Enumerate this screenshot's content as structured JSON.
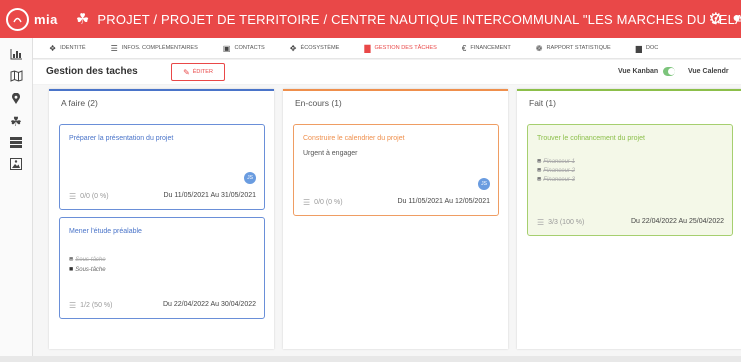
{
  "app": {
    "name": "mia"
  },
  "breadcrumb": "PROJET / PROJET DE TERRITOIRE / CENTRE NAUTIQUE INTERCOMMUNAL \"LES MARCHES DU VELAY\"",
  "colors": {
    "brand": "#e94848",
    "todo": "#4a74c9",
    "inprogress": "#ef8f4c",
    "done": "#8cbf4a"
  },
  "modules": [
    {
      "label": "IDENTITÉ",
      "icon": "fingerprint-icon"
    },
    {
      "label": "INFOS. COMPLÉMENTAIRES",
      "icon": "list-icon"
    },
    {
      "label": "CONTACTS",
      "icon": "contacts-icon"
    },
    {
      "label": "ÉCOSYSTÈME",
      "icon": "ecosystem-icon"
    },
    {
      "label": "GESTION DES TÂCHES",
      "icon": "chart-icon",
      "active": true
    },
    {
      "label": "FINANCEMENT",
      "icon": "euro-icon"
    },
    {
      "label": "RAPPORT STATISTIQUE",
      "icon": "report-icon"
    },
    {
      "label": "DOC",
      "icon": "doc-icon"
    }
  ],
  "header": {
    "title": "Gestion des taches",
    "edit_label": "ÉDITER",
    "view_kanban": "Vue Kanban",
    "view_calendar": "Vue Calendr"
  },
  "columns": {
    "todo": {
      "title": "A faire (2)",
      "cards": [
        {
          "title": "Préparer la présentation du projet",
          "progress": "0/0 (0 %)",
          "dates": "Du 11/05/2021 Au 31/05/2021",
          "avatar": "JS"
        },
        {
          "title": "Mener l'étude préalable",
          "subtasks": [
            "Sous-tâche",
            "Sous-tâche"
          ],
          "progress": "1/2 (50 %)",
          "dates": "Du 22/04/2022 Au 30/04/2022"
        }
      ]
    },
    "inprogress": {
      "title": "En-cours (1)",
      "cards": [
        {
          "title": "Construire le calendrier du projet",
          "note": "Urgent à engager",
          "progress": "0/0 (0 %)",
          "dates": "Du 11/05/2021 Au 12/05/2021",
          "avatar": "JS"
        }
      ]
    },
    "done": {
      "title": "Fait (1)",
      "cards": [
        {
          "title": "Trouver le cofinancement du projet",
          "subtasks": [
            "Financeur 1",
            "Financeur 2",
            "Financeur 3"
          ],
          "progress": "3/3 (100 %)",
          "dates": "Du 22/04/2022 Au 25/04/2022"
        }
      ]
    }
  }
}
